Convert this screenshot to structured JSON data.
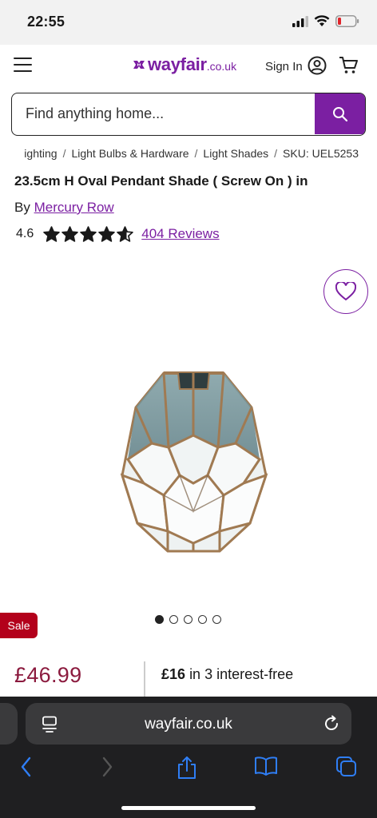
{
  "status": {
    "time": "22:55"
  },
  "header": {
    "logo_word": "wayfair",
    "logo_tld": ".co.uk",
    "signin_label": "Sign In"
  },
  "search": {
    "placeholder": "Find anything home..."
  },
  "breadcrumb": {
    "items": [
      "ighting",
      "Light Bulbs & Hardware",
      "Light Shades",
      "SKU: UEL5253"
    ],
    "separator": "/"
  },
  "product": {
    "title": "23.5cm H Oval Pendant Shade ( Screw On ) in",
    "by_label": "By",
    "brand": "Mercury Row",
    "rating": "4.6",
    "rating_value": 4.6,
    "rating_max": 5,
    "reviews_label": "404 Reviews",
    "sale_badge": "Sale",
    "price": "£46.99",
    "installment_amount": "£16",
    "installment_text": "in 3 interest-free",
    "image_count": 5,
    "active_image_index": 0
  },
  "browser": {
    "url": "wayfair.co.uk"
  },
  "colors": {
    "brand": "#7b1fa2",
    "price": "#8b1a3e",
    "sale": "#b3001b",
    "browser_bg": "#1f1f21",
    "browser_accent": "#2f7ef5"
  }
}
